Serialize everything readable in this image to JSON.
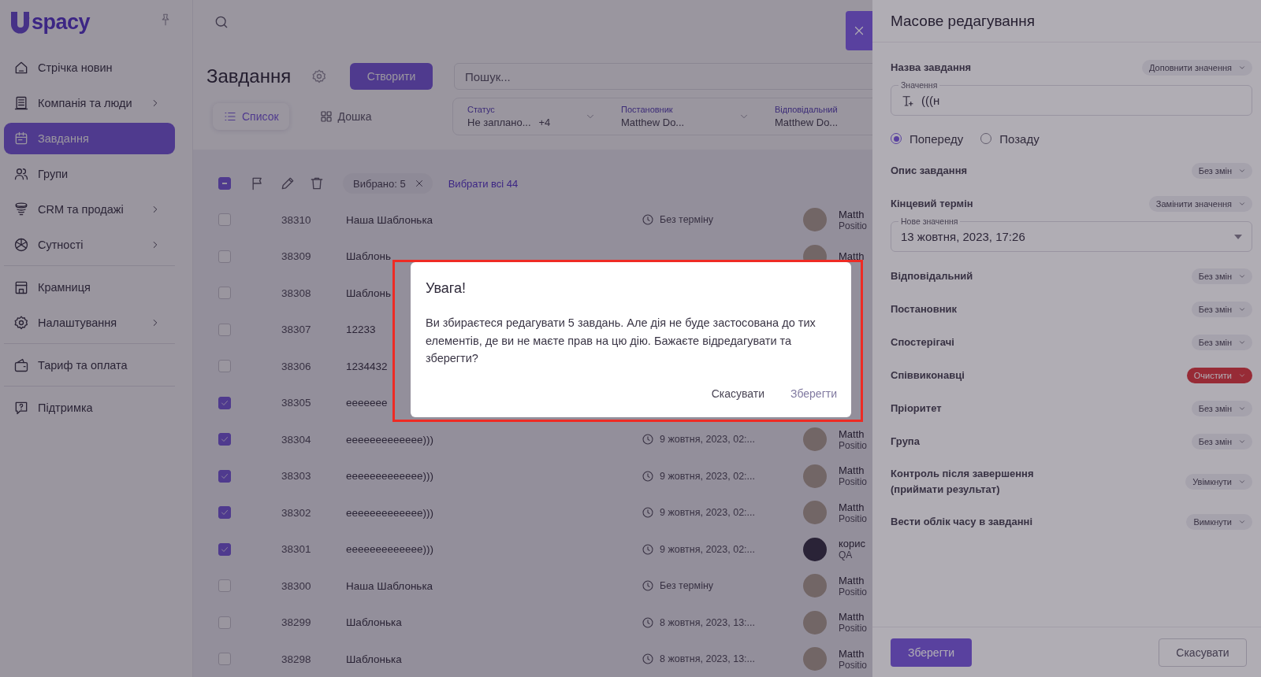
{
  "sidebar": {
    "logo": "spacy",
    "items": [
      {
        "label": "Стрічка новин",
        "kind": "home",
        "selected": false,
        "submenu": false
      },
      {
        "label": "Компанія та люди",
        "kind": "ledger",
        "selected": false,
        "submenu": true
      },
      {
        "label": "Завдання",
        "kind": "calendar",
        "selected": true,
        "submenu": false
      },
      {
        "label": "Групи",
        "kind": "people",
        "selected": false,
        "submenu": false
      },
      {
        "label": "CRM та продажі",
        "kind": "funnel",
        "selected": false,
        "submenu": true
      },
      {
        "label": "Сутності",
        "kind": "sphere",
        "selected": false,
        "submenu": true,
        "divider_after": true
      },
      {
        "label": "Крамниця",
        "kind": "store",
        "selected": false,
        "submenu": false
      },
      {
        "label": "Налаштування",
        "kind": "gear",
        "selected": false,
        "submenu": true,
        "divider_after": true
      },
      {
        "label": "Тариф та оплата",
        "kind": "wallet",
        "selected": false,
        "submenu": false,
        "divider_after": true
      },
      {
        "label": "Підтримка",
        "kind": "help",
        "selected": false,
        "submenu": false
      }
    ]
  },
  "header": {
    "title": "Завдання",
    "create_button": "Створити",
    "search": {
      "placeholder": "Пошук..."
    }
  },
  "views": [
    {
      "label": "Список",
      "kind": "list",
      "selected": true
    },
    {
      "label": "Дошка",
      "kind": "board",
      "selected": false
    }
  ],
  "filters": [
    {
      "label": "Статус",
      "value": "Не заплано...",
      "extra": "+4"
    },
    {
      "label": "Постановник",
      "value": "Matthew Do..."
    },
    {
      "label": "Відповідальний",
      "value": "Matthew Do..."
    }
  ],
  "toolbar": {
    "indeterminate": true,
    "selected_count": "Вибрано: 5",
    "select_all": "Вибрати всі 44"
  },
  "rows": [
    {
      "id": "38310",
      "title": "Наша Шаблонька",
      "checked": false,
      "due": "Без терміну",
      "assignee": "Matth",
      "position": "Positio",
      "kind": "photo"
    },
    {
      "id": "38309",
      "title": "Шаблонь",
      "checked": false,
      "assignee": "Matth",
      "kind": "photo"
    },
    {
      "id": "38308",
      "title": "Шаблонь",
      "checked": false
    },
    {
      "id": "38307",
      "title": "12233",
      "checked": false
    },
    {
      "id": "38306",
      "title": "1234432",
      "checked": false
    },
    {
      "id": "38305",
      "title": "eeeeeee",
      "checked": true
    },
    {
      "id": "38304",
      "title": "eeeeeeeeeeeee)))",
      "checked": true,
      "due": "9 жовтня, 2023, 02:...",
      "assignee": "Matth",
      "position": "Positio",
      "kind": "photo"
    },
    {
      "id": "38303",
      "title": "eeeeeeeeeeeee)))",
      "checked": true,
      "due": "9 жовтня, 2023, 02:...",
      "assignee": "Matth",
      "position": "Positio",
      "kind": "photo"
    },
    {
      "id": "38302",
      "title": "eeeeeeeeeeeee)))",
      "checked": true,
      "due": "9 жовтня, 2023, 02:...",
      "assignee": "Matth",
      "position": "Positio",
      "kind": "photo"
    },
    {
      "id": "38301",
      "title": "eeeeeeeeeeeee)))",
      "checked": true,
      "due": "9 жовтня, 2023, 02:...",
      "assignee": "корис",
      "position": "QA",
      "kind": "default"
    },
    {
      "id": "38300",
      "title": "Наша Шаблонька",
      "checked": false,
      "due": "Без терміну",
      "assignee": "Matth",
      "position": "Positio",
      "kind": "photo"
    },
    {
      "id": "38299",
      "title": "Шаблонька",
      "checked": false,
      "due": "8 жовтня, 2023, 13:...",
      "assignee": "Matth",
      "position": "Positio",
      "kind": "photo"
    },
    {
      "id": "38298",
      "title": "Шаблонька",
      "checked": false,
      "due": "8 жовтня, 2023, 13:...",
      "assignee": "Matth",
      "position": "Positio",
      "kind": "photo"
    }
  ],
  "drawer": {
    "title": "Масове редагування",
    "fields": [
      {
        "kind": "text",
        "label": "Назва завдання",
        "action": {
          "label": "Доповнити значення",
          "destructive": false
        },
        "input_label": "Значення",
        "value": "(((н",
        "positions": [
          {
            "label": "Попереду",
            "selected": true
          },
          {
            "label": "Позаду",
            "selected": false
          }
        ]
      },
      {
        "kind": "plain",
        "label": "Опис завдання",
        "action": {
          "label": "Без змін",
          "destructive": false
        }
      },
      {
        "kind": "date",
        "label": "Кінцевий термін",
        "action": {
          "label": "Замінити значення",
          "destructive": false
        },
        "input_label": "Нове значення",
        "value": "13 жовтня, 2023, 17:26"
      },
      {
        "kind": "plain",
        "label": "Відповідальний",
        "action": {
          "label": "Без змін",
          "destructive": false
        }
      },
      {
        "kind": "plain",
        "label": "Постановник",
        "action": {
          "label": "Без змін",
          "destructive": false
        }
      },
      {
        "kind": "plain",
        "label": "Спостерігачі",
        "action": {
          "label": "Без змін",
          "destructive": false
        }
      },
      {
        "kind": "plain",
        "label": "Співвиконавці",
        "action": {
          "label": "Очистити",
          "destructive": true
        }
      },
      {
        "kind": "plain",
        "label": "Пріоритет",
        "action": {
          "label": "Без змін",
          "destructive": false
        }
      },
      {
        "kind": "plain",
        "label": "Група",
        "action": {
          "label": "Без змін",
          "destructive": false
        }
      },
      {
        "kind": "plain",
        "label": "Контроль після завершення (приймати результат)",
        "action": {
          "label": "Увімкнути",
          "destructive": false
        }
      },
      {
        "kind": "plain",
        "label": "Вести облік часу в завданні",
        "action": {
          "label": "Вимкнути",
          "destructive": false
        }
      }
    ],
    "save": "Зберегти",
    "cancel": "Скасувати"
  },
  "dialog": {
    "title": "Увага!",
    "message": "Ви збираєтеся редагувати 5 завдань. Але дія не буде застосована до тих елементів, де ви не маєте прав на цю дію. Бажаєте відредагувати та зберегти?",
    "buttons": [
      {
        "label": "Скасувати",
        "disabled": false
      },
      {
        "label": "Зберегти",
        "disabled": true
      }
    ]
  }
}
